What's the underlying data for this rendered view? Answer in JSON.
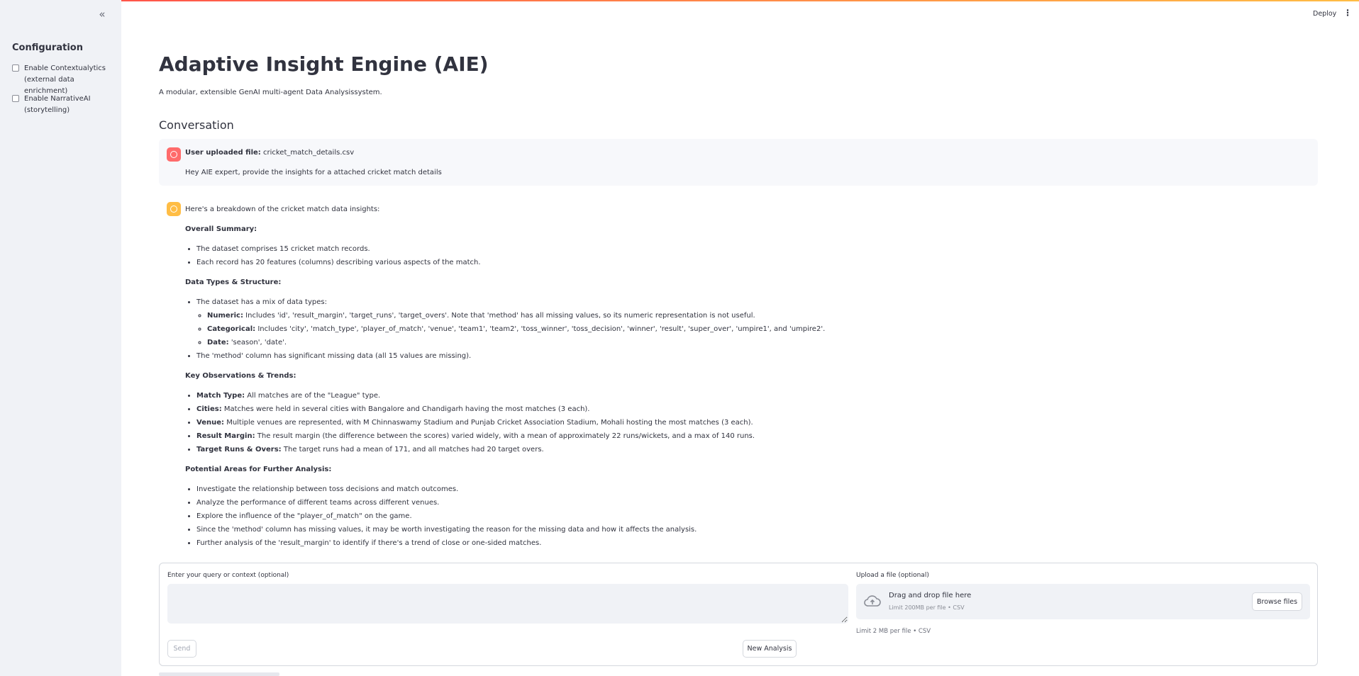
{
  "header": {
    "deploy_label": "Deploy",
    "menu_icon": "vertical-dots-icon"
  },
  "sidebar": {
    "collapse_glyph": "«",
    "title": "Configuration",
    "options": [
      {
        "label": "Enable Contextualytics (external data enrichment)",
        "checked": false
      },
      {
        "label": "Enable NarrativeAI (storytelling)",
        "checked": false
      }
    ]
  },
  "main": {
    "title": "Adaptive Insight Engine (AIE)",
    "subtitle": "A modular, extensible GenAI multi-agent Data Analysissystem.",
    "conversation_heading": "Conversation",
    "user_message": {
      "upload_prefix": "User uploaded file:",
      "file_name": "cricket_match_details.csv",
      "text": "Hey AIE expert, provide the insights for a attached cricket match details"
    },
    "assistant_message": {
      "intro": "Here's a breakdown of the cricket match data insights:",
      "overall_heading": "Overall Summary:",
      "overall_items": [
        "The dataset comprises 15 cricket match records.",
        "Each record has 20 features (columns) describing various aspects of the match."
      ],
      "types_heading": "Data Types & Structure:",
      "types_intro": "The dataset has a mix of data types:",
      "types_sub": [
        {
          "label": "Numeric:",
          "text": "Includes 'id', 'result_margin', 'target_runs', 'target_overs'. Note that 'method' has all missing values, so its numeric representation is not useful."
        },
        {
          "label": "Categorical:",
          "text": "Includes 'city', 'match_type', 'player_of_match', 'venue', 'team1', 'team2', 'toss_winner', 'toss_decision', 'winner', 'result', 'super_over', 'umpire1', and 'umpire2'."
        },
        {
          "label": "Date:",
          "text": "'season', 'date'."
        }
      ],
      "types_missing": "The 'method' column has significant missing data (all 15 values are missing).",
      "obs_heading": "Key Observations & Trends:",
      "obs_items": [
        {
          "label": "Match Type:",
          "text": "All matches are of the \"League\" type."
        },
        {
          "label": "Cities:",
          "text": "Matches were held in several cities with Bangalore and Chandigarh having the most matches (3 each)."
        },
        {
          "label": "Venue:",
          "text": "Multiple venues are represented, with M Chinnaswamy Stadium and Punjab Cricket Association Stadium, Mohali hosting the most matches (3 each)."
        },
        {
          "label": "Result Margin:",
          "text": "The result margin (the difference between the scores) varied widely, with a mean of approximately 22 runs/wickets, and a max of 140 runs."
        },
        {
          "label": "Target Runs & Overs:",
          "text": "The target runs had a mean of 171, and all matches had 20 target overs."
        }
      ],
      "further_heading": "Potential Areas for Further Analysis:",
      "further_items": [
        "Investigate the relationship between toss decisions and match outcomes.",
        "Analyze the performance of different teams across different venues.",
        "Explore the influence of the \"player_of_match\" on the game.",
        "Since the 'method' column has missing values, it may be worth investigating the reason for the missing data and how it affects the analysis.",
        "Further analysis of the 'result_margin' to identify if there's a trend of close or one-sided matches."
      ]
    }
  },
  "input_panel": {
    "query_label": "Enter your query or context (optional)",
    "query_value": "",
    "send_label": "Send",
    "new_analysis_label": "New Analysis",
    "upload_label": "Upload a file (optional)",
    "drop_title": "Drag and drop file here",
    "drop_sub": "Limit 200MB per file • CSV",
    "browse_label": "Browse files",
    "limit_note": "Limit 2 MB per file • CSV"
  },
  "colors": {
    "sidebar_bg": "#f0f2f6",
    "user_avatar": "#ff6b6b",
    "bot_avatar": "#ffbd45",
    "accent": "#ff4b4b"
  }
}
